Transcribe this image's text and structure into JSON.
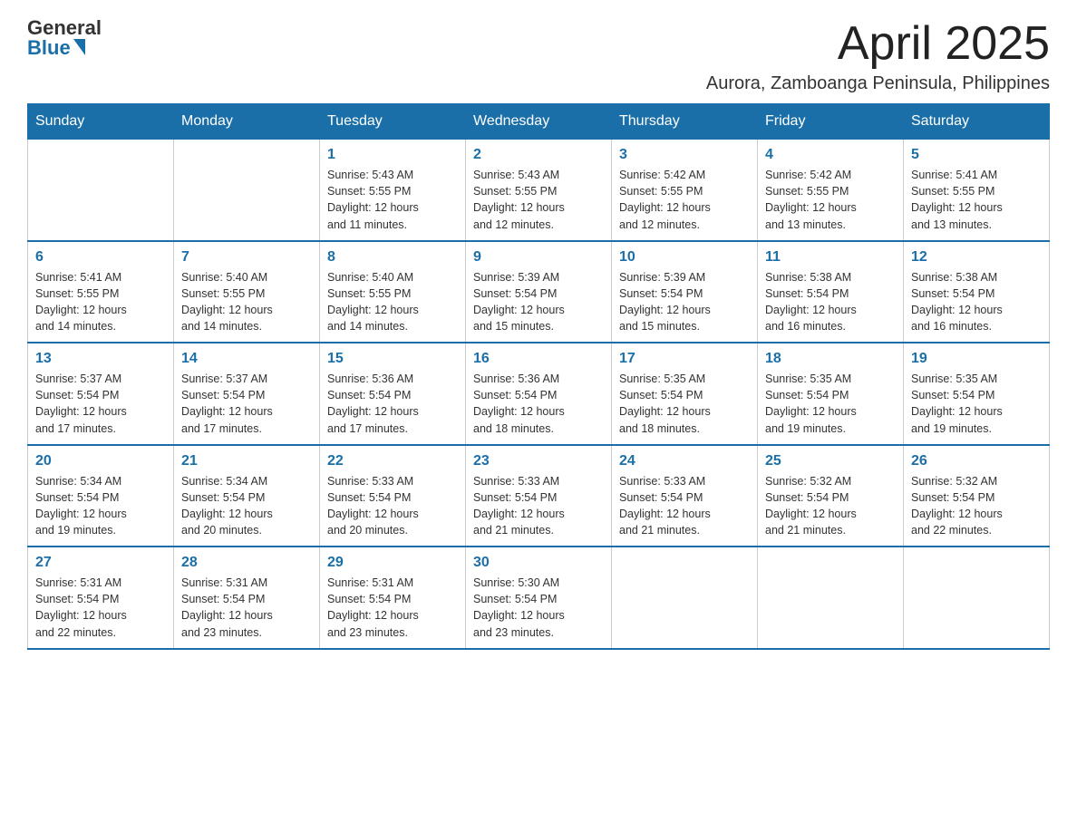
{
  "logo": {
    "general": "General",
    "blue": "Blue"
  },
  "title": "April 2025",
  "location": "Aurora, Zamboanga Peninsula, Philippines",
  "days_of_week": [
    "Sunday",
    "Monday",
    "Tuesday",
    "Wednesday",
    "Thursday",
    "Friday",
    "Saturday"
  ],
  "weeks": [
    [
      {
        "day": "",
        "info": ""
      },
      {
        "day": "",
        "info": ""
      },
      {
        "day": "1",
        "info": "Sunrise: 5:43 AM\nSunset: 5:55 PM\nDaylight: 12 hours\nand 11 minutes."
      },
      {
        "day": "2",
        "info": "Sunrise: 5:43 AM\nSunset: 5:55 PM\nDaylight: 12 hours\nand 12 minutes."
      },
      {
        "day": "3",
        "info": "Sunrise: 5:42 AM\nSunset: 5:55 PM\nDaylight: 12 hours\nand 12 minutes."
      },
      {
        "day": "4",
        "info": "Sunrise: 5:42 AM\nSunset: 5:55 PM\nDaylight: 12 hours\nand 13 minutes."
      },
      {
        "day": "5",
        "info": "Sunrise: 5:41 AM\nSunset: 5:55 PM\nDaylight: 12 hours\nand 13 minutes."
      }
    ],
    [
      {
        "day": "6",
        "info": "Sunrise: 5:41 AM\nSunset: 5:55 PM\nDaylight: 12 hours\nand 14 minutes."
      },
      {
        "day": "7",
        "info": "Sunrise: 5:40 AM\nSunset: 5:55 PM\nDaylight: 12 hours\nand 14 minutes."
      },
      {
        "day": "8",
        "info": "Sunrise: 5:40 AM\nSunset: 5:55 PM\nDaylight: 12 hours\nand 14 minutes."
      },
      {
        "day": "9",
        "info": "Sunrise: 5:39 AM\nSunset: 5:54 PM\nDaylight: 12 hours\nand 15 minutes."
      },
      {
        "day": "10",
        "info": "Sunrise: 5:39 AM\nSunset: 5:54 PM\nDaylight: 12 hours\nand 15 minutes."
      },
      {
        "day": "11",
        "info": "Sunrise: 5:38 AM\nSunset: 5:54 PM\nDaylight: 12 hours\nand 16 minutes."
      },
      {
        "day": "12",
        "info": "Sunrise: 5:38 AM\nSunset: 5:54 PM\nDaylight: 12 hours\nand 16 minutes."
      }
    ],
    [
      {
        "day": "13",
        "info": "Sunrise: 5:37 AM\nSunset: 5:54 PM\nDaylight: 12 hours\nand 17 minutes."
      },
      {
        "day": "14",
        "info": "Sunrise: 5:37 AM\nSunset: 5:54 PM\nDaylight: 12 hours\nand 17 minutes."
      },
      {
        "day": "15",
        "info": "Sunrise: 5:36 AM\nSunset: 5:54 PM\nDaylight: 12 hours\nand 17 minutes."
      },
      {
        "day": "16",
        "info": "Sunrise: 5:36 AM\nSunset: 5:54 PM\nDaylight: 12 hours\nand 18 minutes."
      },
      {
        "day": "17",
        "info": "Sunrise: 5:35 AM\nSunset: 5:54 PM\nDaylight: 12 hours\nand 18 minutes."
      },
      {
        "day": "18",
        "info": "Sunrise: 5:35 AM\nSunset: 5:54 PM\nDaylight: 12 hours\nand 19 minutes."
      },
      {
        "day": "19",
        "info": "Sunrise: 5:35 AM\nSunset: 5:54 PM\nDaylight: 12 hours\nand 19 minutes."
      }
    ],
    [
      {
        "day": "20",
        "info": "Sunrise: 5:34 AM\nSunset: 5:54 PM\nDaylight: 12 hours\nand 19 minutes."
      },
      {
        "day": "21",
        "info": "Sunrise: 5:34 AM\nSunset: 5:54 PM\nDaylight: 12 hours\nand 20 minutes."
      },
      {
        "day": "22",
        "info": "Sunrise: 5:33 AM\nSunset: 5:54 PM\nDaylight: 12 hours\nand 20 minutes."
      },
      {
        "day": "23",
        "info": "Sunrise: 5:33 AM\nSunset: 5:54 PM\nDaylight: 12 hours\nand 21 minutes."
      },
      {
        "day": "24",
        "info": "Sunrise: 5:33 AM\nSunset: 5:54 PM\nDaylight: 12 hours\nand 21 minutes."
      },
      {
        "day": "25",
        "info": "Sunrise: 5:32 AM\nSunset: 5:54 PM\nDaylight: 12 hours\nand 21 minutes."
      },
      {
        "day": "26",
        "info": "Sunrise: 5:32 AM\nSunset: 5:54 PM\nDaylight: 12 hours\nand 22 minutes."
      }
    ],
    [
      {
        "day": "27",
        "info": "Sunrise: 5:31 AM\nSunset: 5:54 PM\nDaylight: 12 hours\nand 22 minutes."
      },
      {
        "day": "28",
        "info": "Sunrise: 5:31 AM\nSunset: 5:54 PM\nDaylight: 12 hours\nand 23 minutes."
      },
      {
        "day": "29",
        "info": "Sunrise: 5:31 AM\nSunset: 5:54 PM\nDaylight: 12 hours\nand 23 minutes."
      },
      {
        "day": "30",
        "info": "Sunrise: 5:30 AM\nSunset: 5:54 PM\nDaylight: 12 hours\nand 23 minutes."
      },
      {
        "day": "",
        "info": ""
      },
      {
        "day": "",
        "info": ""
      },
      {
        "day": "",
        "info": ""
      }
    ]
  ]
}
